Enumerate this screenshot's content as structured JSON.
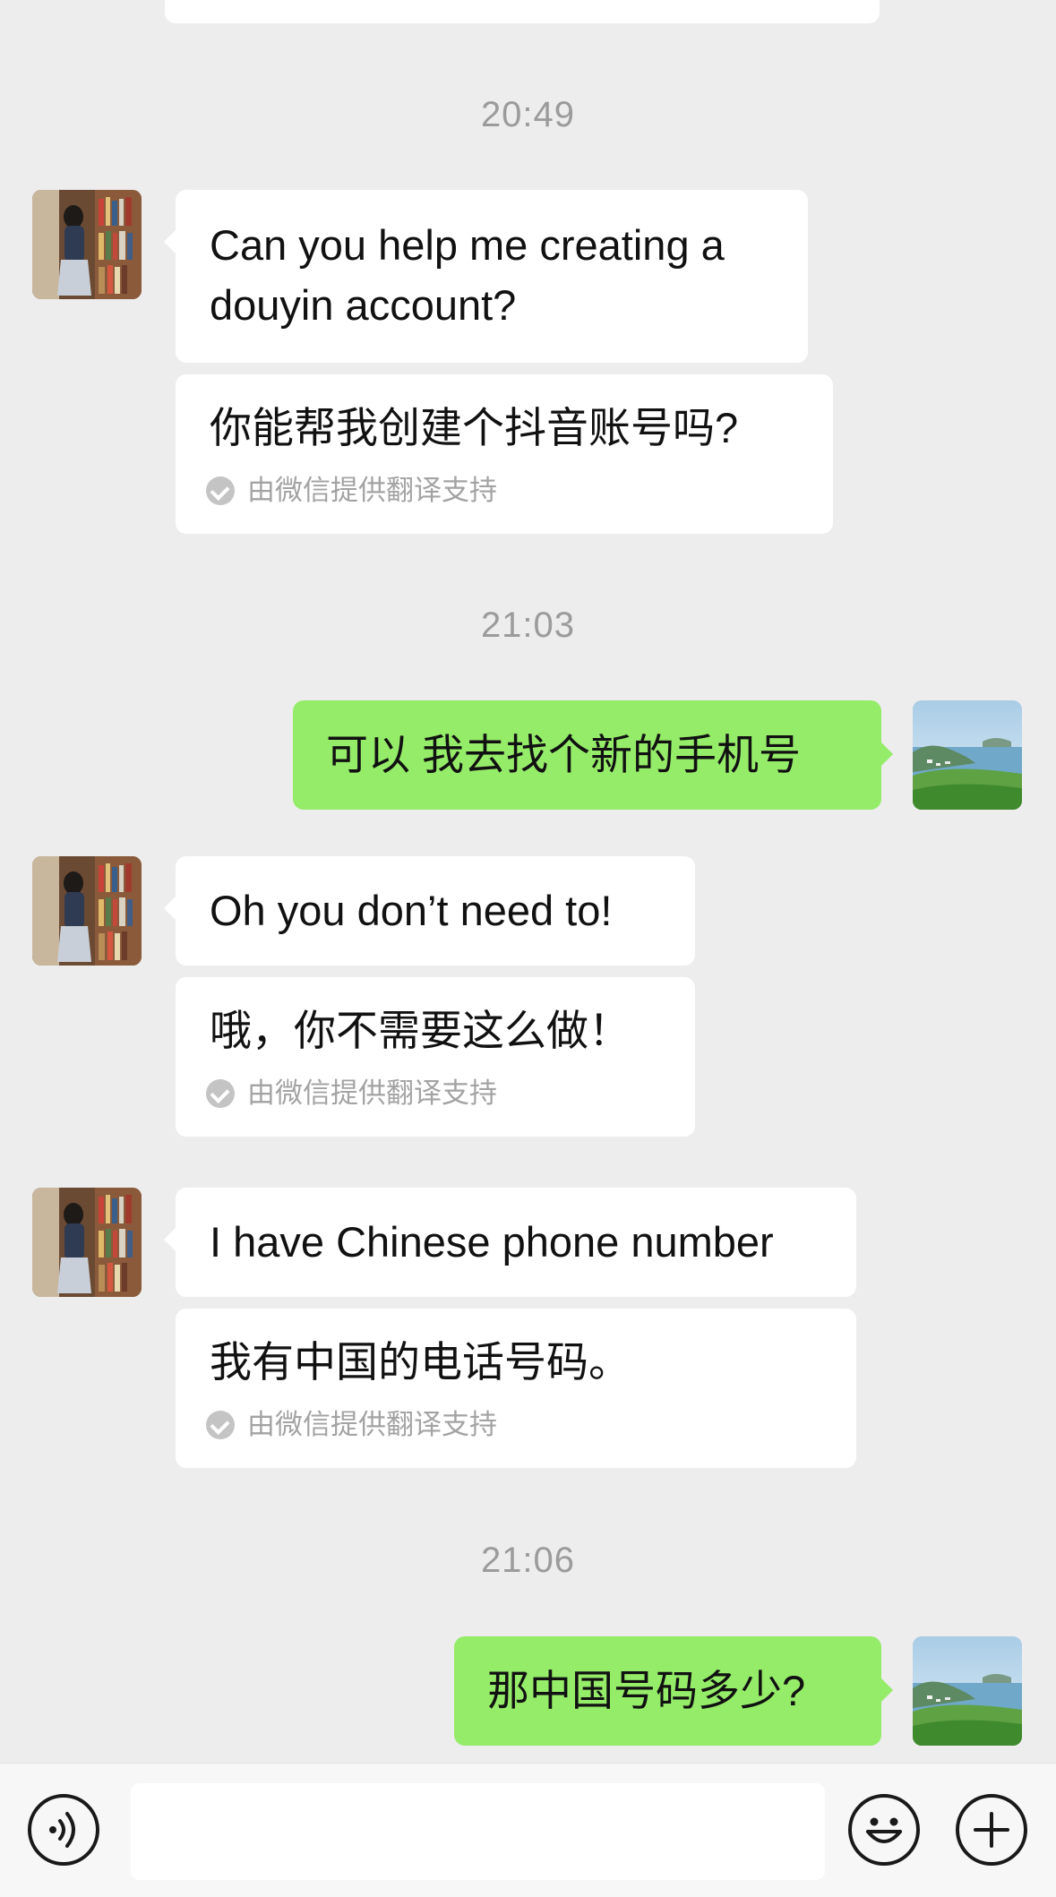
{
  "messages": [
    {
      "time": "20:49"
    },
    {
      "sender": "other",
      "text": "Can you help me creating a douyin account?",
      "translation": "你能帮我创建个抖音账号吗?",
      "translation_note": "由微信提供翻译支持"
    },
    {
      "time": "21:03"
    },
    {
      "sender": "me",
      "text": "可以 我去找个新的手机号"
    },
    {
      "sender": "other",
      "text": "Oh you don’t need to!",
      "translation": "哦，你不需要这么做！",
      "translation_note": "由微信提供翻译支持"
    },
    {
      "sender": "other",
      "text": "I have Chinese phone number",
      "translation": "我有中国的电话号码。",
      "translation_note": "由微信提供翻译支持"
    },
    {
      "time": "21:06"
    },
    {
      "sender": "me",
      "text": "那中国号码多少?"
    }
  ],
  "input_bar": {
    "voice_icon": "voice-icon",
    "emoji_icon": "emoji-icon",
    "plus_icon": "plus-icon",
    "input_value": ""
  },
  "colors": {
    "background": "#ededed",
    "my_bubble": "#95ec69",
    "other_bubble": "#ffffff",
    "timestamp": "#9b9b9b"
  }
}
